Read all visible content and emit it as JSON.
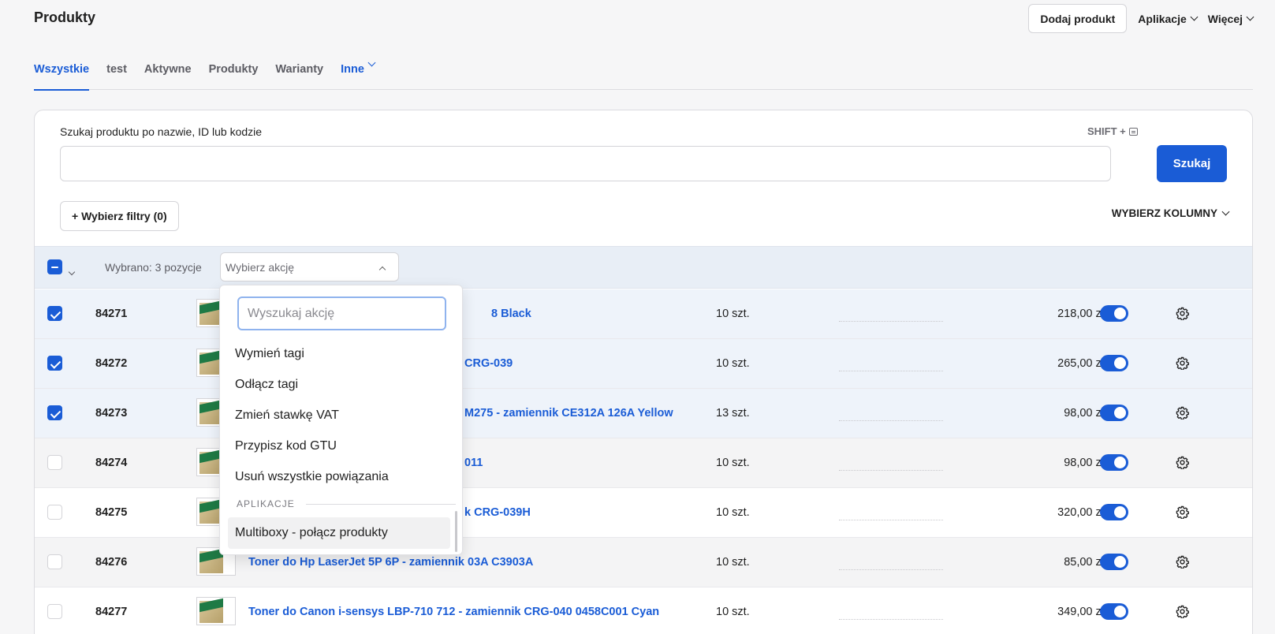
{
  "page_title": "Produkty",
  "header": {
    "add_product": "Dodaj produkt",
    "apps": "Aplikacje",
    "more": "Więcej"
  },
  "tabs": [
    {
      "label": "Wszystkie"
    },
    {
      "label": "test"
    },
    {
      "label": "Aktywne"
    },
    {
      "label": "Produkty"
    },
    {
      "label": "Warianty"
    },
    {
      "label": "Inne"
    }
  ],
  "search": {
    "label": "Szukaj produktu po nazwie, ID lub kodzie",
    "shortcut": "SHIFT +",
    "value": "",
    "button": "Szukaj"
  },
  "filters": {
    "button": "+ Wybierz filtry (0)",
    "columns": "WYBIERZ KOLUMNY"
  },
  "bulk": {
    "selected_text": "Wybrano: 3 pozycje",
    "action_placeholder": "Wybierz akcję"
  },
  "rows": [
    {
      "id": "84271",
      "name": "8 Black",
      "stock": "10 szt.",
      "price": "218,00 zł"
    },
    {
      "id": "84272",
      "name": "CRG-039",
      "stock": "10 szt.",
      "price": "265,00 zł"
    },
    {
      "id": "84273",
      "name": "M275 - zamiennik CE312A 126A Yellow",
      "stock": "13 szt.",
      "price": "98,00 zł"
    },
    {
      "id": "84274",
      "name": "011",
      "stock": "10 szt.",
      "price": "98,00 zł"
    },
    {
      "id": "84275",
      "name": "k CRG-039H",
      "stock": "10 szt.",
      "price": "320,00 zł"
    },
    {
      "id": "84276",
      "name": "Toner do Hp LaserJet 5P 6P - zamiennik 03A C3903A",
      "stock": "10 szt.",
      "price": "85,00 zł"
    },
    {
      "id": "84277",
      "name": "Toner do Canon i-sensys LBP-710 712 - zamiennik CRG-040 0458C001 Cyan",
      "stock": "10 szt.",
      "price": "349,00 zł"
    }
  ],
  "dropdown": {
    "search_placeholder": "Wyszukaj akcję",
    "items": [
      {
        "label": "Wymień tagi"
      },
      {
        "label": "Odłącz tagi"
      },
      {
        "label": "Zmień stawkę VAT"
      },
      {
        "label": "Przypisz kod GTU"
      },
      {
        "label": "Usuń wszystkie powiązania"
      }
    ],
    "group_label": "APLIKACJE",
    "group_items": [
      {
        "label": "Multiboxy - połącz produkty"
      }
    ]
  },
  "colors": {
    "accent": "#1a5cd6",
    "selected_row": "#eef3fa"
  }
}
